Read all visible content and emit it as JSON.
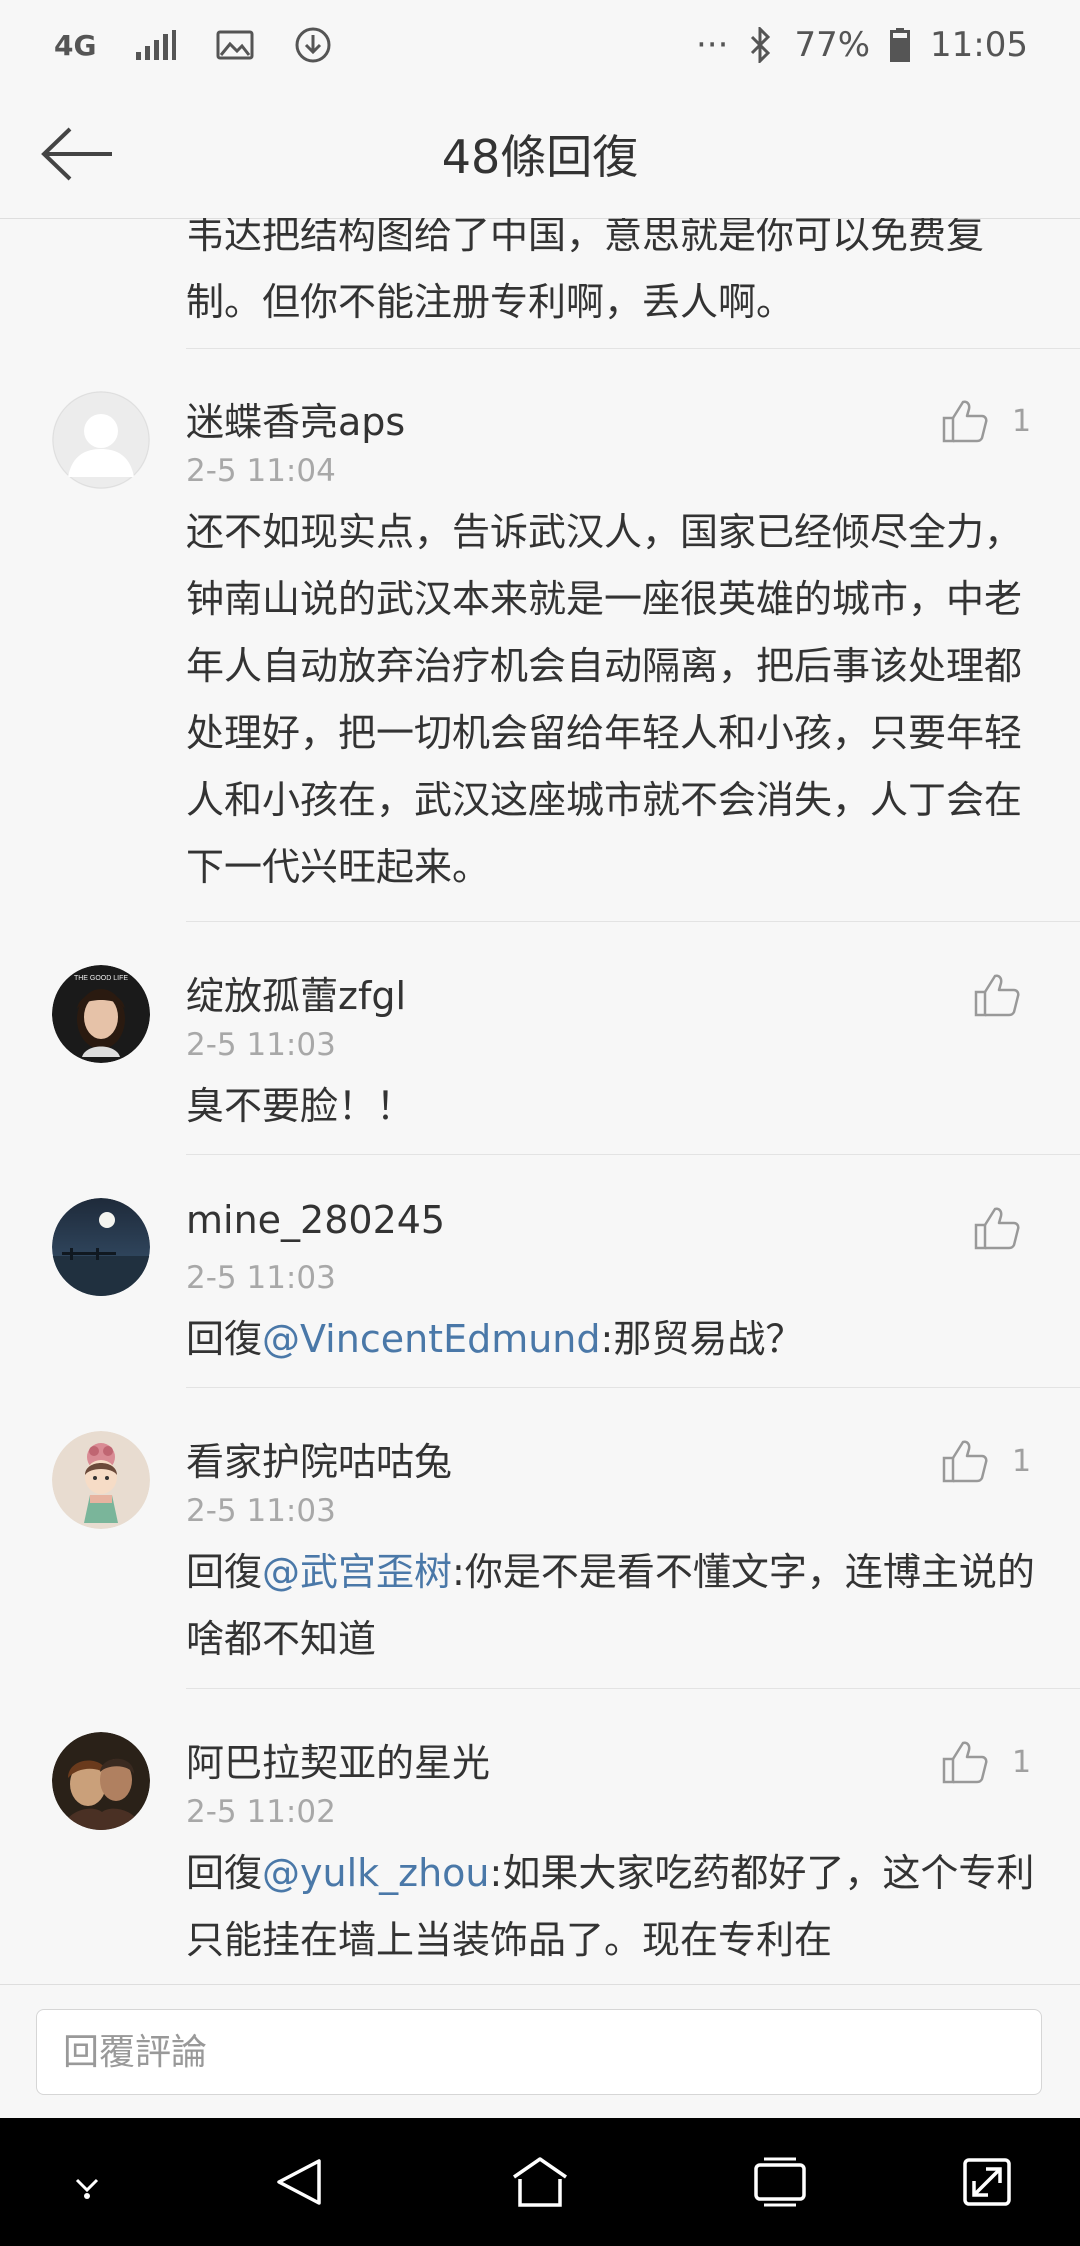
{
  "status_bar": {
    "network": "4G",
    "battery": "77%",
    "time": "11:05",
    "more": "···",
    "icons": [
      "network-4g-icon",
      "signal-icon",
      "gallery-icon",
      "download-icon",
      "bluetooth-icon",
      "battery-icon"
    ]
  },
  "header": {
    "title": "48條回復",
    "back_icon": "back-arrow-icon"
  },
  "comments": [
    {
      "body": "韦达把结构图给了中国，意思就是你可以免费复制。但你不能注册专利啊，丢人啊。"
    },
    {
      "username": "迷蝶香亮aps",
      "time": "2-5 11:04",
      "likes": "1",
      "avatar": "default-avatar",
      "body": "还不如现实点，告诉武汉人，国家已经倾尽全力，钟南山说的武汉本来就是一座很英雄的城市，中老年人自动放弃治疗机会自动隔离，把后事该处理都处理好，把一切机会留给年轻人和小孩，只要年轻人和小孩在，武汉这座城市就不会消失，人丁会在下一代兴旺起来。"
    },
    {
      "username": "绽放孤蕾zfgl",
      "time": "2-5 11:03",
      "likes": "",
      "avatar": "woman-portrait",
      "body": "臭不要脸！！"
    },
    {
      "username": "mine_280245",
      "time": "2-5 11:03",
      "likes": "",
      "avatar": "night-moon-scene",
      "reply_prefix": "回復",
      "mention": "@VincentEdmund",
      "body": ":那贸易战？"
    },
    {
      "username": "看家护院咕咕兔",
      "time": "2-5 11:03",
      "likes": "1",
      "avatar": "cartoon-girl",
      "reply_prefix": "回復",
      "mention": "@武宫歪树",
      "body": ":你是不是看不懂文字，连博主说的啥都不知道"
    },
    {
      "username": "阿巴拉契亚的星光",
      "time": "2-5 11:02",
      "likes": "1",
      "avatar": "couple-photo",
      "reply_prefix": "回復",
      "mention": "@yulk_zhou",
      "body": ":如果大家吃药都好了，这个专利只能挂在墙上当装饰品了。现在专利在"
    }
  ],
  "input": {
    "placeholder": "回覆評論"
  },
  "nav_bar": {
    "icons": [
      "nav-hide-icon",
      "nav-back-icon",
      "nav-home-icon",
      "nav-recents-icon",
      "nav-expand-icon"
    ]
  },
  "colors": {
    "background": "#f7f7f7",
    "mention": "#4a78a8",
    "timestamp": "#a8a8a8",
    "nav_bar": "#000000"
  }
}
